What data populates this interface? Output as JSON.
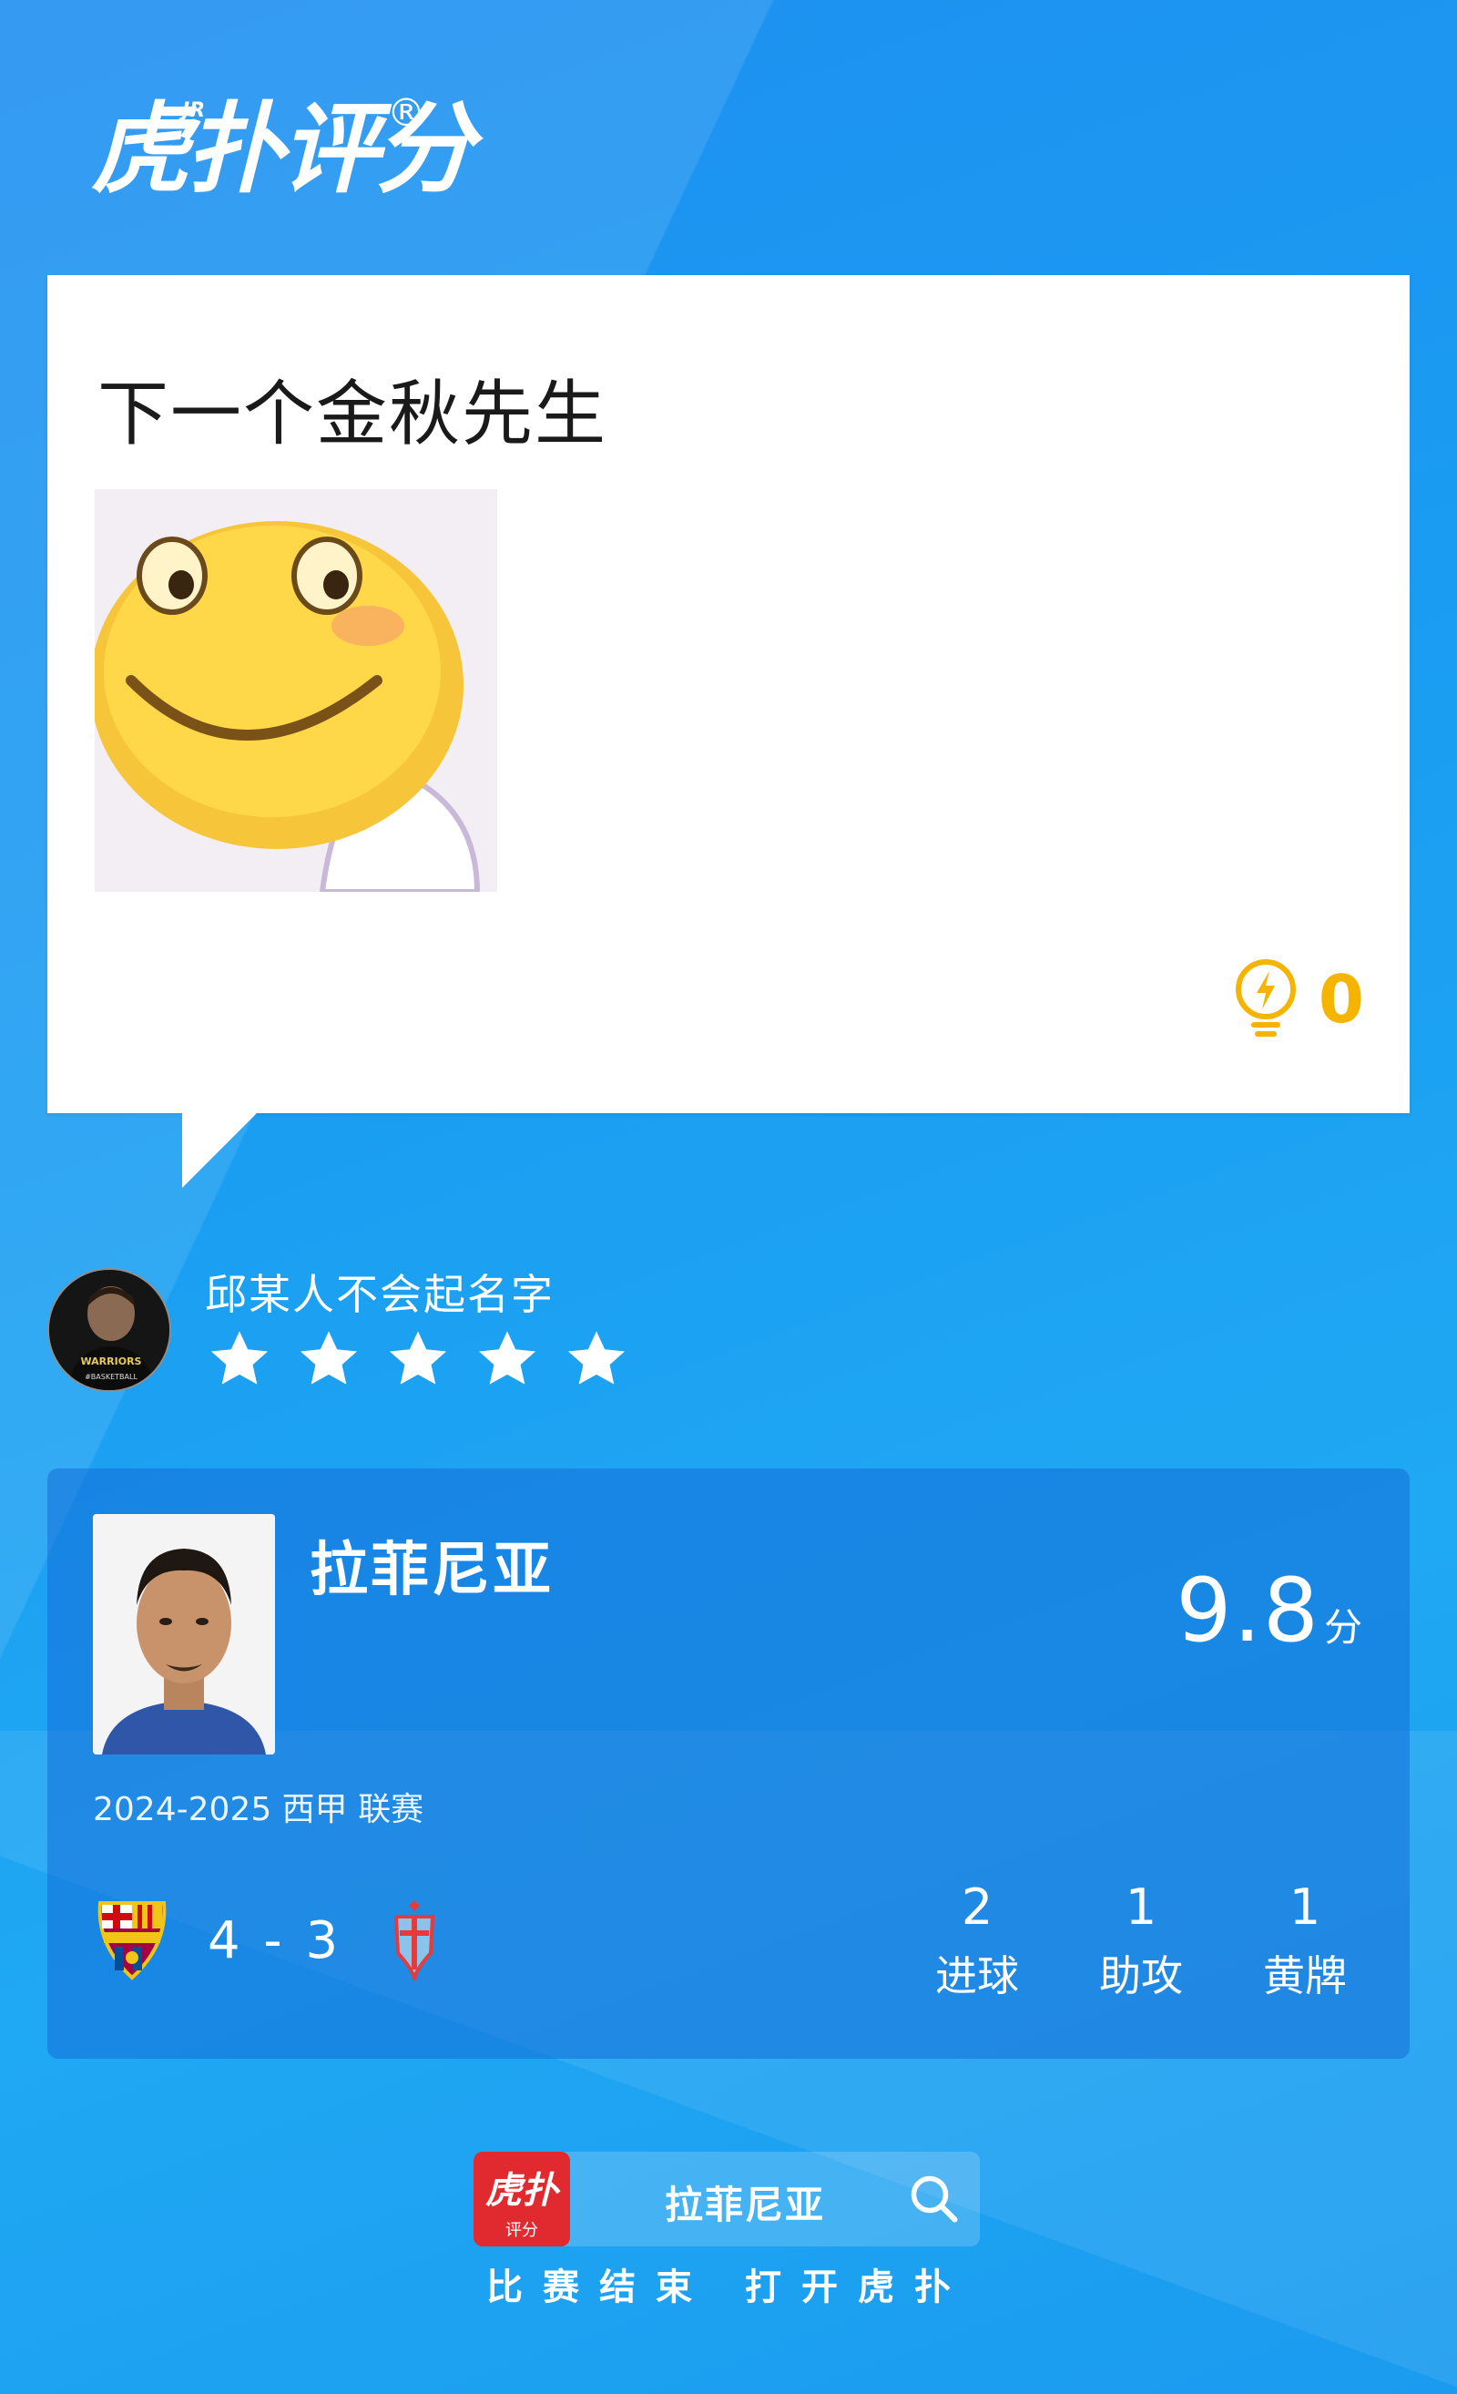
{
  "brand": {
    "logo_text": "虎扑评分",
    "logo_superscript": "JR",
    "registered_mark": "®"
  },
  "comment": {
    "text": "下一个金秋先生",
    "like_count": "0",
    "like_icon": "lightbulb-bolt-icon",
    "sticker": "smiley-face-sticker"
  },
  "user": {
    "name": "邱某人不会起名字",
    "rating_stars": 5,
    "avatar_jersey": "WARRIORS #BASKETBALL"
  },
  "player": {
    "name": "拉菲尼亚",
    "score": "9.8",
    "score_unit": "分",
    "season": "2024-2025 西甲 联赛",
    "match": {
      "home_badge": "fc-barcelona-crest-icon",
      "away_badge": "celta-vigo-crest-icon",
      "score": "4 - 3"
    },
    "stats": [
      {
        "value": "2",
        "label": "进球"
      },
      {
        "value": "1",
        "label": "助攻"
      },
      {
        "value": "1",
        "label": "黄牌"
      }
    ]
  },
  "search": {
    "app_icon_title": "虎扑",
    "app_icon_sub": "评分",
    "query": "拉菲尼亚"
  },
  "footer": {
    "text": "比赛结束 打开虎扑"
  },
  "colors": {
    "background": "#1a9df2",
    "card": "#ffffff",
    "like_accent": "#f5b400",
    "app_icon": "#e12a30"
  }
}
